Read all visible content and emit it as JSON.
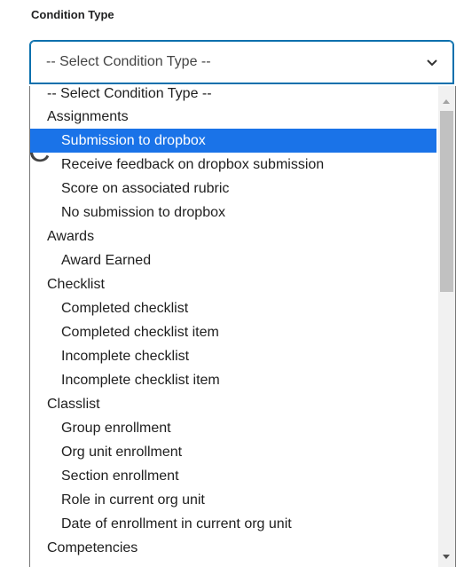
{
  "field": {
    "label": "Condition Type"
  },
  "select": {
    "value": "-- Select Condition Type --"
  },
  "backdrop": {
    "partial_text": "C"
  },
  "options": [
    {
      "label": "-- Select Condition Type --",
      "kind": "placeholder"
    },
    {
      "label": "Assignments",
      "kind": "group"
    },
    {
      "label": "Submission to dropbox",
      "kind": "child",
      "selected": true
    },
    {
      "label": "Receive feedback on dropbox submission",
      "kind": "child"
    },
    {
      "label": "Score on associated rubric",
      "kind": "child"
    },
    {
      "label": "No submission to dropbox",
      "kind": "child"
    },
    {
      "label": "Awards",
      "kind": "group"
    },
    {
      "label": "Award Earned",
      "kind": "child"
    },
    {
      "label": "Checklist",
      "kind": "group"
    },
    {
      "label": "Completed checklist",
      "kind": "child"
    },
    {
      "label": "Completed checklist item",
      "kind": "child"
    },
    {
      "label": "Incomplete checklist",
      "kind": "child"
    },
    {
      "label": "Incomplete checklist item",
      "kind": "child"
    },
    {
      "label": "Classlist",
      "kind": "group"
    },
    {
      "label": "Group enrollment",
      "kind": "child"
    },
    {
      "label": "Org unit enrollment",
      "kind": "child"
    },
    {
      "label": "Section enrollment",
      "kind": "child"
    },
    {
      "label": "Role in current org unit",
      "kind": "child"
    },
    {
      "label": "Date of enrollment in current org unit",
      "kind": "child"
    },
    {
      "label": "Competencies",
      "kind": "group"
    }
  ],
  "colors": {
    "focus_border": "#0a70ad",
    "highlight": "#1a73e8"
  }
}
